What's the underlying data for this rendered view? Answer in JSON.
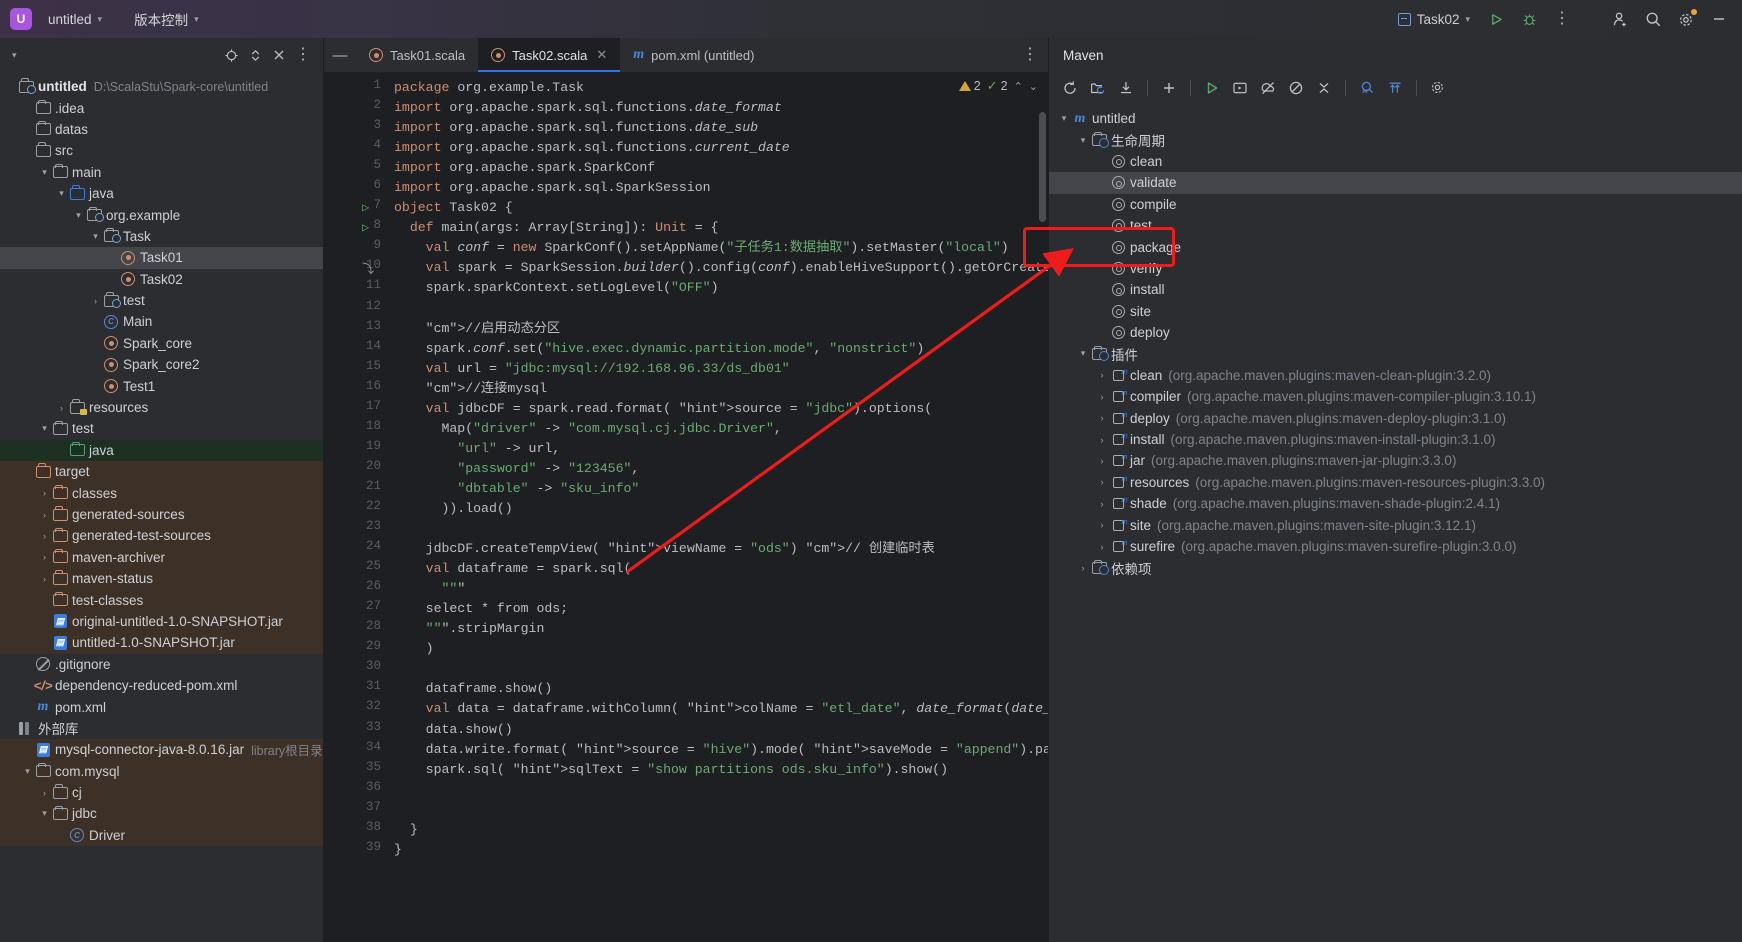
{
  "titlebar": {
    "project_badge": "U",
    "project_name": "untitled",
    "vcs_menu": "版本控制",
    "run_config": "Task02",
    "icons": {
      "run": "run-icon",
      "debug": "debug-icon",
      "more": "more-options-icon",
      "user": "add-user-icon",
      "search": "search-icon",
      "settings": "settings-icon",
      "minimize": "minimize-icon"
    }
  },
  "project_panel": {
    "header_icons": [
      "locate-icon",
      "expand-collapse-icon",
      "collapse-all-icon",
      "options-icon"
    ],
    "tree": [
      {
        "depth": 0,
        "label": "untitled",
        "sub": "D:\\ScalaStu\\Spark-core\\untitled",
        "icon": "module-icon",
        "arrow": "",
        "bold": true,
        "state": ""
      },
      {
        "depth": 1,
        "label": ".idea",
        "sub": "",
        "icon": "folder",
        "arrow": "",
        "bold": false,
        "state": ""
      },
      {
        "depth": 1,
        "label": "datas",
        "sub": "",
        "icon": "folder",
        "arrow": "",
        "bold": false,
        "state": ""
      },
      {
        "depth": 1,
        "label": "src",
        "sub": "",
        "icon": "folder",
        "arrow": "",
        "bold": false,
        "state": ""
      },
      {
        "depth": 2,
        "label": "main",
        "sub": "",
        "icon": "folder",
        "arrow": "▾",
        "bold": false,
        "state": ""
      },
      {
        "depth": 3,
        "label": "java",
        "sub": "",
        "icon": "folder-blue",
        "arrow": "▾",
        "bold": false,
        "state": ""
      },
      {
        "depth": 4,
        "label": "org.example",
        "sub": "",
        "icon": "package",
        "arrow": "▾",
        "bold": false,
        "state": ""
      },
      {
        "depth": 5,
        "label": "Task",
        "sub": "",
        "icon": "package",
        "arrow": "▾",
        "bold": false,
        "state": ""
      },
      {
        "depth": 6,
        "label": "Task01",
        "sub": "",
        "icon": "scala-object",
        "arrow": "",
        "bold": false,
        "state": "sel"
      },
      {
        "depth": 6,
        "label": "Task02",
        "sub": "",
        "icon": "scala-object",
        "arrow": "",
        "bold": false,
        "state": ""
      },
      {
        "depth": 5,
        "label": "test",
        "sub": "",
        "icon": "package",
        "arrow": "›",
        "bold": false,
        "state": ""
      },
      {
        "depth": 5,
        "label": "Main",
        "sub": "",
        "icon": "java-class",
        "arrow": "",
        "bold": false,
        "state": ""
      },
      {
        "depth": 5,
        "label": "Spark_core",
        "sub": "",
        "icon": "scala-object",
        "arrow": "",
        "bold": false,
        "state": ""
      },
      {
        "depth": 5,
        "label": "Spark_core2",
        "sub": "",
        "icon": "scala-object",
        "arrow": "",
        "bold": false,
        "state": ""
      },
      {
        "depth": 5,
        "label": "Test1",
        "sub": "",
        "icon": "scala-object",
        "arrow": "",
        "bold": false,
        "state": ""
      },
      {
        "depth": 3,
        "label": "resources",
        "sub": "",
        "icon": "folder-resources",
        "arrow": "›",
        "bold": false,
        "state": ""
      },
      {
        "depth": 2,
        "label": "test",
        "sub": "",
        "icon": "folder",
        "arrow": "▾",
        "bold": false,
        "state": ""
      },
      {
        "depth": 3,
        "label": "java",
        "sub": "",
        "icon": "folder-green",
        "arrow": "",
        "bold": false,
        "state": "green"
      },
      {
        "depth": 1,
        "label": "target",
        "sub": "",
        "icon": "folder-orange",
        "arrow": "",
        "bold": false,
        "state": "brown"
      },
      {
        "depth": 2,
        "label": "classes",
        "sub": "",
        "icon": "folder-orange",
        "arrow": "›",
        "bold": false,
        "state": "brown"
      },
      {
        "depth": 2,
        "label": "generated-sources",
        "sub": "",
        "icon": "folder-orange",
        "arrow": "›",
        "bold": false,
        "state": "brown"
      },
      {
        "depth": 2,
        "label": "generated-test-sources",
        "sub": "",
        "icon": "folder-orange",
        "arrow": "›",
        "bold": false,
        "state": "brown"
      },
      {
        "depth": 2,
        "label": "maven-archiver",
        "sub": "",
        "icon": "folder-orange",
        "arrow": "›",
        "bold": false,
        "state": "brown"
      },
      {
        "depth": 2,
        "label": "maven-status",
        "sub": "",
        "icon": "folder-orange",
        "arrow": "›",
        "bold": false,
        "state": "brown"
      },
      {
        "depth": 2,
        "label": "test-classes",
        "sub": "",
        "icon": "folder-orange",
        "arrow": "",
        "bold": false,
        "state": "brown"
      },
      {
        "depth": 2,
        "label": "original-untitled-1.0-SNAPSHOT.jar",
        "sub": "",
        "icon": "jar",
        "arrow": "",
        "bold": false,
        "state": "brown"
      },
      {
        "depth": 2,
        "label": "untitled-1.0-SNAPSHOT.jar",
        "sub": "",
        "icon": "jar",
        "arrow": "",
        "bold": false,
        "state": "brown"
      },
      {
        "depth": 1,
        "label": ".gitignore",
        "sub": "",
        "icon": "gitignore",
        "arrow": "",
        "bold": false,
        "state": ""
      },
      {
        "depth": 1,
        "label": "dependency-reduced-pom.xml",
        "sub": "",
        "icon": "xml",
        "arrow": "",
        "bold": false,
        "state": ""
      },
      {
        "depth": 1,
        "label": "pom.xml",
        "sub": "",
        "icon": "maven",
        "arrow": "",
        "bold": false,
        "state": ""
      },
      {
        "depth": 0,
        "label": "外部库",
        "sub": "",
        "icon": "library",
        "arrow": "",
        "bold": false,
        "state": ""
      },
      {
        "depth": 1,
        "label": "mysql-connector-java-8.0.16.jar",
        "sub": "library根目录",
        "icon": "jar",
        "arrow": "",
        "bold": false,
        "state": "brown"
      },
      {
        "depth": 1,
        "label": "com.mysql",
        "sub": "",
        "icon": "folder",
        "arrow": "▾",
        "bold": false,
        "state": "brown"
      },
      {
        "depth": 2,
        "label": "cj",
        "sub": "",
        "icon": "folder",
        "arrow": "›",
        "bold": false,
        "state": "brown"
      },
      {
        "depth": 2,
        "label": "jdbc",
        "sub": "",
        "icon": "folder",
        "arrow": "▾",
        "bold": false,
        "state": "brown"
      },
      {
        "depth": 3,
        "label": "Driver",
        "sub": "",
        "icon": "java-class",
        "arrow": "",
        "bold": false,
        "state": "brown"
      }
    ]
  },
  "editor": {
    "tabs": [
      {
        "label": "Task01.scala",
        "icon": "scala-object-icon",
        "active": false,
        "closable": false
      },
      {
        "label": "Task02.scala",
        "icon": "scala-object-icon",
        "active": true,
        "closable": true
      },
      {
        "label": "pom.xml (untitled)",
        "icon": "maven-icon",
        "active": false,
        "closable": false
      }
    ],
    "inspection": {
      "warnings": "2",
      "checks": "2"
    },
    "lines": [
      {
        "n": 1,
        "mark": ""
      },
      {
        "n": 2,
        "mark": ""
      },
      {
        "n": 3,
        "mark": ""
      },
      {
        "n": 4,
        "mark": ""
      },
      {
        "n": 5,
        "mark": ""
      },
      {
        "n": 6,
        "mark": ""
      },
      {
        "n": 7,
        "mark": "run"
      },
      {
        "n": 8,
        "mark": "run"
      },
      {
        "n": 9,
        "mark": ""
      },
      {
        "n": 10,
        "mark": "impl"
      },
      {
        "n": 11,
        "mark": ""
      },
      {
        "n": 12,
        "mark": ""
      },
      {
        "n": 13,
        "mark": ""
      },
      {
        "n": 14,
        "mark": ""
      },
      {
        "n": 15,
        "mark": ""
      },
      {
        "n": 16,
        "mark": ""
      },
      {
        "n": 17,
        "mark": ""
      },
      {
        "n": 18,
        "mark": ""
      },
      {
        "n": 19,
        "mark": ""
      },
      {
        "n": 20,
        "mark": ""
      },
      {
        "n": 21,
        "mark": ""
      },
      {
        "n": 22,
        "mark": ""
      },
      {
        "n": 23,
        "mark": ""
      },
      {
        "n": 24,
        "mark": ""
      },
      {
        "n": 25,
        "mark": ""
      },
      {
        "n": 26,
        "mark": ""
      },
      {
        "n": 27,
        "mark": ""
      },
      {
        "n": 28,
        "mark": ""
      },
      {
        "n": 29,
        "mark": ""
      },
      {
        "n": 30,
        "mark": ""
      },
      {
        "n": 31,
        "mark": ""
      },
      {
        "n": 32,
        "mark": ""
      },
      {
        "n": 33,
        "mark": ""
      },
      {
        "n": 34,
        "mark": ""
      },
      {
        "n": 35,
        "mark": ""
      },
      {
        "n": 36,
        "mark": ""
      },
      {
        "n": 37,
        "mark": ""
      },
      {
        "n": 38,
        "mark": ""
      },
      {
        "n": 39,
        "mark": ""
      }
    ],
    "source_text": [
      "package org.example.Task",
      "import org.apache.spark.sql.functions.date_format",
      "import org.apache.spark.sql.functions.date_sub",
      "import org.apache.spark.sql.functions.current_date",
      "import org.apache.spark.SparkConf",
      "import org.apache.spark.sql.SparkSession",
      "object Task02 {",
      "  def main(args: Array[String]): Unit = {",
      "    val conf = new SparkConf().setAppName(\"子任务1:数据抽取\").setMaster(\"local\")",
      "    val spark = SparkSession.builder().config(conf).enableHiveSupport().getOrCreate()",
      "    spark.sparkContext.setLogLevel(\"OFF\")",
      "",
      "    //启用动态分区",
      "    spark.conf.set(\"hive.exec.dynamic.partition.mode\", \"nonstrict\")",
      "    val url = \"jdbc:mysql://192.168.96.33/ds_db01\"",
      "    //连接mysql",
      "    val jdbcDF = spark.read.format( source = \"jdbc\").options(",
      "      Map(\"driver\" -> \"com.mysql.cj.jdbc.Driver\",",
      "        \"url\" -> url,",
      "        \"password\" -> \"123456\",",
      "        \"dbtable\" -> \"sku_info\"",
      "      )).load()",
      "",
      "    jdbcDF.createTempView( viewName = \"ods\") // 创建临时表",
      "    val dataframe = spark.sql(",
      "      \"\"\"",
      "    select * from ods;",
      "    \"\"\".stripMargin",
      "    )",
      "",
      "    dataframe.show()",
      "    val data = dataframe.withColumn( colName = \"etl_date\", date_format(date_sub(current_date(",
      "    data.show()",
      "    data.write.format( source = \"hive\").mode( saveMode = \"append\").partitionBy( colNames = \"etl_",
      "    spark.sql( sqlText = \"show partitions ods.sku_info\").show()",
      "",
      "",
      "  }",
      "}"
    ]
  },
  "maven_panel": {
    "title": "Maven",
    "toolbar_icons": [
      "reload-icon",
      "reload-all-icon",
      "download-sources-icon",
      "add-icon",
      "run-maven-build-icon",
      "execute-goal-icon",
      "toggle-offline-icon",
      "skip-tests-icon",
      "collapse-all-icon",
      "analyze-dependencies-icon",
      "show-order-icon",
      "maven-settings-icon"
    ],
    "tree": [
      {
        "depth": 0,
        "label": "untitled",
        "gav": "",
        "icon": "maven-module",
        "arrow": "▾",
        "state": ""
      },
      {
        "depth": 1,
        "label": "生命周期",
        "gav": "",
        "icon": "phase-folder",
        "arrow": "▾",
        "state": ""
      },
      {
        "depth": 2,
        "label": "clean",
        "gav": "",
        "icon": "goal",
        "arrow": "",
        "state": ""
      },
      {
        "depth": 2,
        "label": "validate",
        "gav": "",
        "icon": "goal",
        "arrow": "",
        "state": "sel"
      },
      {
        "depth": 2,
        "label": "compile",
        "gav": "",
        "icon": "goal",
        "arrow": "",
        "state": ""
      },
      {
        "depth": 2,
        "label": "test",
        "gav": "",
        "icon": "goal",
        "arrow": "",
        "state": ""
      },
      {
        "depth": 2,
        "label": "package",
        "gav": "",
        "icon": "goal",
        "arrow": "",
        "state": ""
      },
      {
        "depth": 2,
        "label": "verify",
        "gav": "",
        "icon": "goal",
        "arrow": "",
        "state": ""
      },
      {
        "depth": 2,
        "label": "install",
        "gav": "",
        "icon": "goal",
        "arrow": "",
        "state": ""
      },
      {
        "depth": 2,
        "label": "site",
        "gav": "",
        "icon": "goal",
        "arrow": "",
        "state": ""
      },
      {
        "depth": 2,
        "label": "deploy",
        "gav": "",
        "icon": "goal",
        "arrow": "",
        "state": ""
      },
      {
        "depth": 1,
        "label": "插件",
        "gav": "",
        "icon": "plugin-folder",
        "arrow": "▾",
        "state": ""
      },
      {
        "depth": 2,
        "label": "clean",
        "gav": "(org.apache.maven.plugins:maven-clean-plugin:3.2.0)",
        "icon": "plugin",
        "arrow": "›",
        "state": ""
      },
      {
        "depth": 2,
        "label": "compiler",
        "gav": "(org.apache.maven.plugins:maven-compiler-plugin:3.10.1)",
        "icon": "plugin",
        "arrow": "›",
        "state": ""
      },
      {
        "depth": 2,
        "label": "deploy",
        "gav": "(org.apache.maven.plugins:maven-deploy-plugin:3.1.0)",
        "icon": "plugin",
        "arrow": "›",
        "state": ""
      },
      {
        "depth": 2,
        "label": "install",
        "gav": "(org.apache.maven.plugins:maven-install-plugin:3.1.0)",
        "icon": "plugin",
        "arrow": "›",
        "state": ""
      },
      {
        "depth": 2,
        "label": "jar",
        "gav": "(org.apache.maven.plugins:maven-jar-plugin:3.3.0)",
        "icon": "plugin",
        "arrow": "›",
        "state": ""
      },
      {
        "depth": 2,
        "label": "resources",
        "gav": "(org.apache.maven.plugins:maven-resources-plugin:3.3.0)",
        "icon": "plugin",
        "arrow": "›",
        "state": ""
      },
      {
        "depth": 2,
        "label": "shade",
        "gav": "(org.apache.maven.plugins:maven-shade-plugin:2.4.1)",
        "icon": "plugin",
        "arrow": "›",
        "state": ""
      },
      {
        "depth": 2,
        "label": "site",
        "gav": "(org.apache.maven.plugins:maven-site-plugin:3.12.1)",
        "icon": "plugin",
        "arrow": "›",
        "state": ""
      },
      {
        "depth": 2,
        "label": "surefire",
        "gav": "(org.apache.maven.plugins:maven-surefire-plugin:3.0.0)",
        "icon": "plugin",
        "arrow": "›",
        "state": ""
      },
      {
        "depth": 1,
        "label": "依赖项",
        "gav": "",
        "icon": "dependency-folder",
        "arrow": "›",
        "state": ""
      }
    ]
  },
  "annotation": {
    "highlight_target": "package",
    "color": "#f01c1c"
  }
}
